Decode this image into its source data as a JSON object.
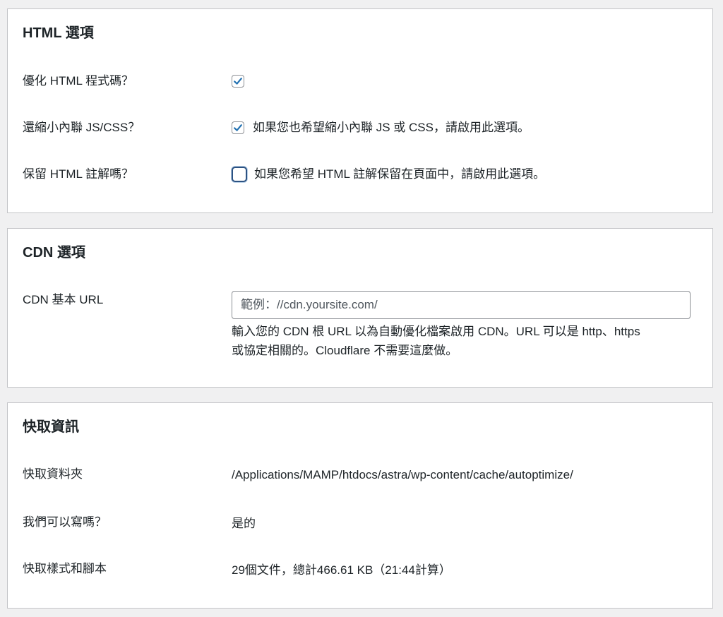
{
  "html_options": {
    "title": "HTML 選項",
    "rows": [
      {
        "label": "優化 HTML 程式碼？",
        "checked": true,
        "description": ""
      },
      {
        "label": "還縮小內聯 JS/CSS？",
        "checked": true,
        "description": "如果您也希望縮小內聯 JS 或 CSS，請啟用此選項。"
      },
      {
        "label": "保留 HTML 註解嗎？",
        "checked": false,
        "description": "如果您希望 HTML 註解保留在頁面中，請啟用此選項。"
      }
    ]
  },
  "cdn_options": {
    "title": "CDN 選項",
    "base_url_label": "CDN 基本 URL",
    "base_url_value": "",
    "base_url_placeholder": "範例：//cdn.yoursite.com/",
    "description_line1": "輸入您的 CDN 根 URL 以為自動優化檔案啟用 CDN。URL 可以是 http、https",
    "description_line2": "或協定相關的。Cloudflare 不需要這麼做。"
  },
  "cache_info": {
    "title": "快取資訊",
    "rows": [
      {
        "label": "快取資料夾",
        "value": "/Applications/MAMP/htdocs/astra/wp-content/cache/autoptimize/"
      },
      {
        "label": "我們可以寫嗎？",
        "value": "是的"
      },
      {
        "label": "快取樣式和腳本",
        "value": "29個文件，總計466.61 KB（21:44計算）"
      }
    ]
  },
  "colors": {
    "page_background": "#f0f0f1",
    "panel_border": "#c3c4c7",
    "checkmark": "#2271b1",
    "focus_border": "#2c5282"
  },
  "icons": {
    "checkmark": "checkmark-icon"
  }
}
